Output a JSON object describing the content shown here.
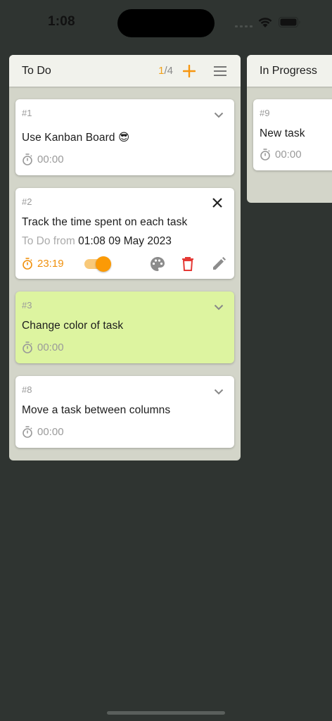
{
  "status_bar": {
    "time": "1:08"
  },
  "columns": [
    {
      "title": "To Do",
      "count_current": "1",
      "count_total": "/4",
      "cards": [
        {
          "id": "#1",
          "title": "Use Kanban Board 😎",
          "timer": "00:00"
        },
        {
          "id": "#2",
          "title": "Track the time spent on each task",
          "status_label": "To Do from",
          "status_time": "01:08 09 May 2023",
          "timer": "23:19"
        },
        {
          "id": "#3",
          "title": "Change color of task",
          "timer": "00:00"
        },
        {
          "id": "#8",
          "title": "Move a task between columns",
          "timer": "00:00"
        }
      ]
    },
    {
      "title": "In Progress",
      "cards": [
        {
          "id": "#9",
          "title": "New task",
          "timer": "00:00"
        }
      ]
    }
  ],
  "colors": {
    "accent": "#f0900c",
    "delete": "#e53935",
    "card_green": "#ddf4a0",
    "column_bg": "#d3d5c9",
    "background": "#2f3431"
  },
  "icons": [
    "add-icon",
    "menu-icon",
    "chevron-down-icon",
    "close-icon",
    "timer-icon",
    "palette-icon",
    "delete-icon",
    "edit-icon"
  ]
}
